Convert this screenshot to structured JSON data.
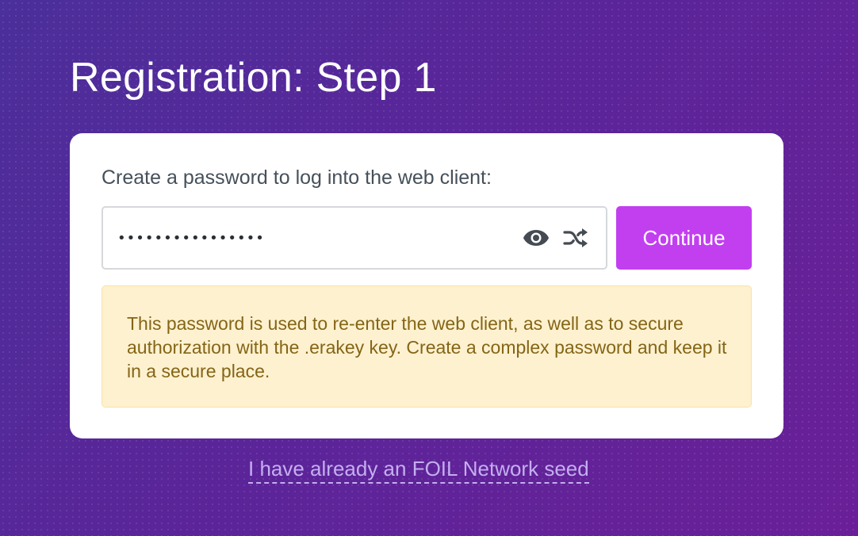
{
  "page": {
    "title": "Registration: Step 1"
  },
  "form": {
    "prompt": "Create a password to log into the web client:",
    "password_value": "••••••••••••••••",
    "password_placeholder": "",
    "show_password_icon": "eye-icon",
    "generate_password_icon": "shuffle-icon",
    "continue_label": "Continue",
    "notice": "This password is used to re-enter the web client, as well as to secure authorization with the .erakey key. Create a complex password and keep it in a secure place."
  },
  "footer": {
    "seed_link_label": "I have already an FOIL Network seed"
  },
  "colors": {
    "accent": "#c23ff0",
    "background_start": "#4b2f9a",
    "background_end": "#6a1f98",
    "notice_background": "#fdf1d0",
    "notice_text": "#856516",
    "link": "#c4aef0"
  }
}
